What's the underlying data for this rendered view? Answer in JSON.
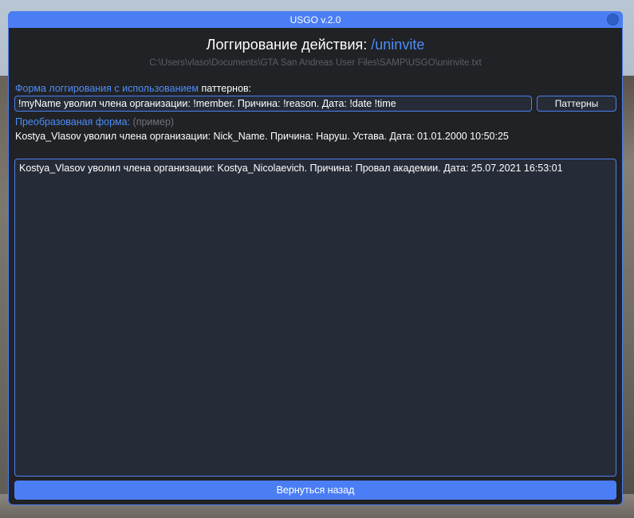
{
  "window": {
    "title": "USGO v.2.0"
  },
  "header": {
    "title_prefix": "Логгирование действия:",
    "command": "/uninvite",
    "file_path": "C:\\Users\\vlaso\\Documents\\GTA San Andreas User Files\\SAMP\\USGO\\uninvite.txt"
  },
  "form": {
    "label_highlight": "Форма логгирования с использованием",
    "label_rest": "паттернов:",
    "pattern_value": "!myName уволил члена организации: !member. Причина: !reason. Дата: !date !time",
    "patterns_button": "Паттерны",
    "converted_label": "Преобразованая форма:",
    "converted_hint": "(пример)",
    "example_text": "Kostya_Vlasov уволил члена организации: Nick_Name. Причина: Наруш. Устава. Дата: 01.01.2000 10:50:25"
  },
  "log": {
    "lines": [
      "Kostya_Vlasov уволил члена организации: Kostya_Nicolaevich. Причина: Провал академии. Дата: 25.07.2021 16:53:01"
    ]
  },
  "footer": {
    "back_button": "Вернуться назад"
  },
  "colors": {
    "accent": "#4b7ef5",
    "window_bg": "#212226",
    "field_bg": "#262b38",
    "muted": "#5b5e66"
  }
}
